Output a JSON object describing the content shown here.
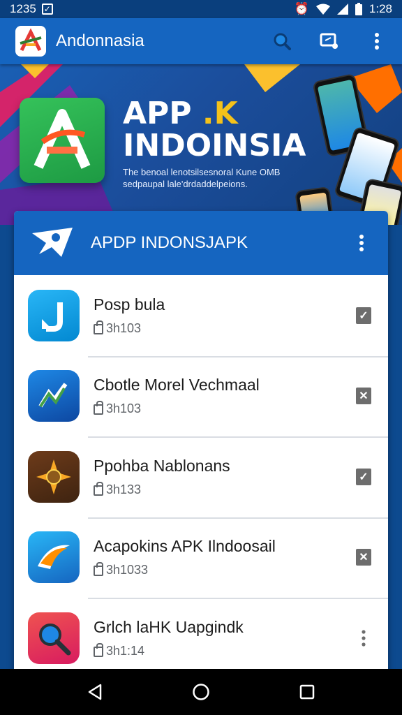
{
  "status_bar": {
    "time_left": "1235",
    "time_right": "1:28"
  },
  "app_bar": {
    "title": "Andonnasia"
  },
  "banner": {
    "title_line1_a": "APP",
    "title_line1_b": ".K",
    "title_line2": "INDOINSIA",
    "subtitle": "The benoal lenotsilsesnoral Kune OMB sedpaupal lale'drdaddelpeions."
  },
  "card": {
    "title": "APDP INDONSJAPK",
    "items": [
      {
        "name": "Posp bula",
        "meta": "3h103",
        "icon": "arrow-app-icon",
        "action": "check"
      },
      {
        "name": "Cbotle Morel Vechmaal",
        "meta": "3h103",
        "icon": "chart-app-icon",
        "action": "close"
      },
      {
        "name": "Ppohba Nablonans",
        "meta": "3h133",
        "icon": "compass-app-icon",
        "action": "check"
      },
      {
        "name": "Acapokins  APK Ilndoosail",
        "meta": "3h1033",
        "icon": "swoosh-app-icon",
        "action": "close"
      },
      {
        "name": "Grlch laHK Uapgindk",
        "meta": "3h1:14",
        "icon": "search-app-icon",
        "action": "more"
      }
    ]
  },
  "colors": {
    "primary": "#1565c0",
    "status": "#0a3f7d",
    "banner": "#1b4d9b"
  }
}
